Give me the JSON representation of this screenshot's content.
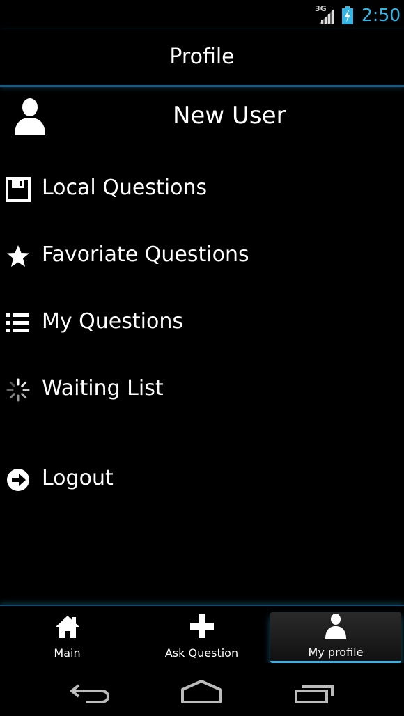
{
  "status_bar": {
    "network": "3G",
    "time": "2:50"
  },
  "header": {
    "title": "Profile"
  },
  "profile": {
    "username": "New User",
    "avatar_icon": "user-icon"
  },
  "menu": {
    "items": [
      {
        "label": "Local Questions",
        "icon": "floppy-disk-icon"
      },
      {
        "label": "Favoriate Questions",
        "icon": "star-icon"
      },
      {
        "label": "My Questions",
        "icon": "list-icon"
      },
      {
        "label": "Waiting List",
        "icon": "spinner-icon"
      },
      {
        "label": "Logout",
        "icon": "arrow-right-circle-icon"
      }
    ]
  },
  "tabs": [
    {
      "label": "Main",
      "icon": "home-icon",
      "selected": false
    },
    {
      "label": "Ask Question",
      "icon": "plus-icon",
      "selected": false
    },
    {
      "label": "My profile",
      "icon": "user-icon",
      "selected": true
    }
  ],
  "system_nav": {
    "buttons": [
      "back-icon",
      "home-outline-icon",
      "recent-apps-icon"
    ]
  },
  "colors": {
    "accent": "#33b5e5",
    "background": "#000000",
    "text": "#ffffff"
  }
}
